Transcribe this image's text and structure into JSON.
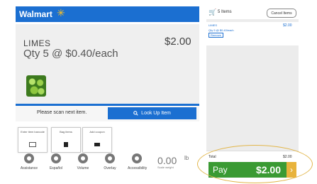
{
  "header": {
    "brand": "Walmart",
    "spark_icon": "spark-icon"
  },
  "item": {
    "name": "LIMES",
    "price": "$2.00",
    "qty_line": "Qty 5 @ $0.40/each",
    "image": "limes-photo"
  },
  "scan": {
    "prompt": "Please scan next item.",
    "lookup_label": "Look Up Item",
    "lookup_icon": "search-icon"
  },
  "tiles": [
    {
      "label": "Enter item barcode",
      "icon": "keyboard-icon"
    },
    {
      "label": "Bag items",
      "icon": "bag-icon"
    },
    {
      "label": "Add coupon",
      "icon": "coupon-icon"
    }
  ],
  "bottom_bar": [
    {
      "label": "Assistance",
      "icon": "help-icon"
    },
    {
      "label": "Español",
      "icon": "language-icon"
    },
    {
      "label": "Volume",
      "icon": "volume-icon"
    },
    {
      "label": "Overlay",
      "icon": "overlay-icon"
    },
    {
      "label": "Accessibility",
      "icon": "accessibility-icon"
    }
  ],
  "scale": {
    "weight": "0.00",
    "unit": "lb",
    "note": "Scale weight"
  },
  "cart": {
    "count_label": "5 Items",
    "cancel_label": "Cancel Items",
    "lines": [
      {
        "name": "LIMES",
        "price": "$2.00",
        "sub": "Qty 5 @ $0.40/each",
        "sub2": "Remove"
      }
    ]
  },
  "totals": {
    "label": "Total",
    "value": "$2.00",
    "pay_label": "Pay",
    "pay_amount": "$2.00"
  },
  "colors": {
    "brand_blue": "#1b6fd1",
    "pay_green": "#3a9a33",
    "accent_yellow": "#ffc220"
  }
}
